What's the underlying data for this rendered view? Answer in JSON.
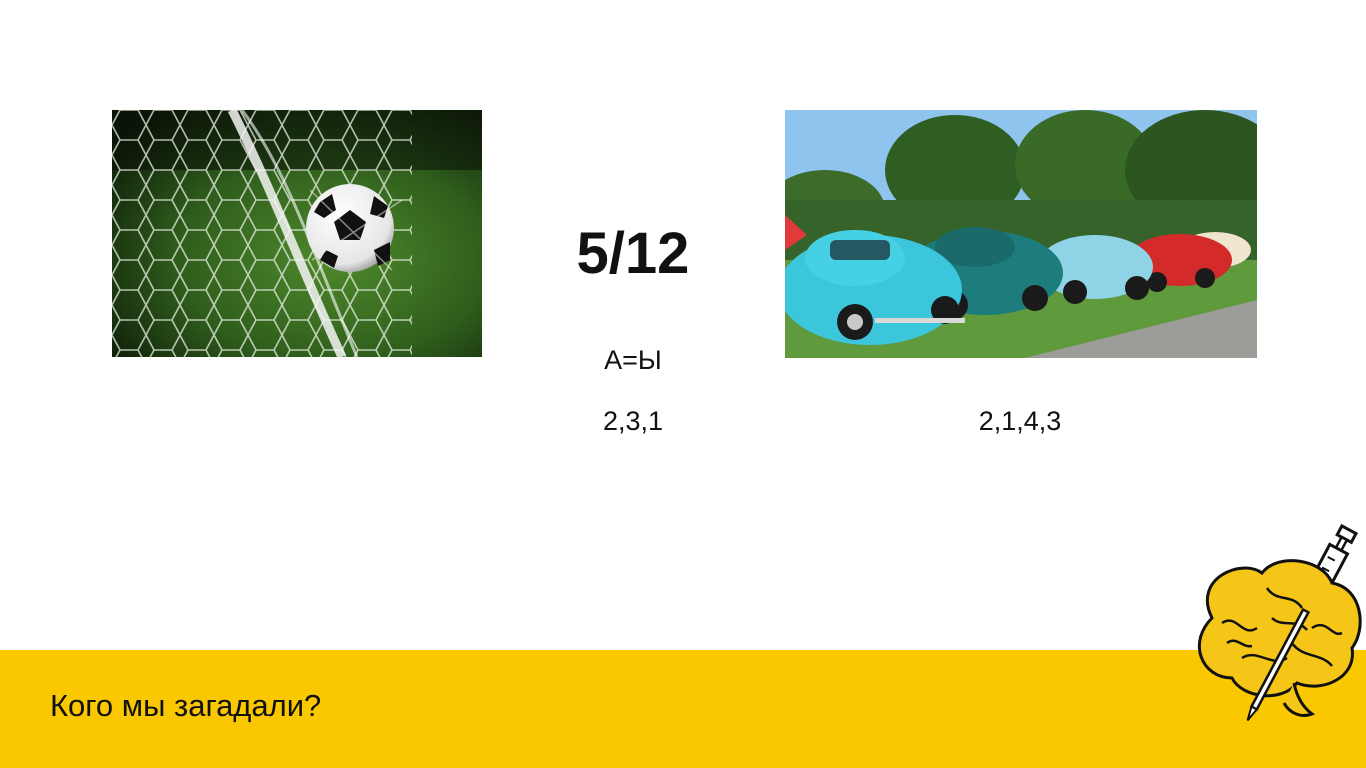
{
  "slide": {
    "counter": "5/12",
    "hints": {
      "letters": "А=Ы",
      "order_left": "2,3,1",
      "order_right": "2,1,4,3"
    },
    "question": "Кого мы загадали?"
  },
  "images": {
    "left": "soccer-ball-in-goal-net-photo",
    "right": "row-of-vintage-beetle-cars-photo",
    "logo": "brain-with-syringe-logo"
  },
  "colors": {
    "background": "#ffffff",
    "accent_bar": "#f9c800",
    "text": "#111111"
  }
}
